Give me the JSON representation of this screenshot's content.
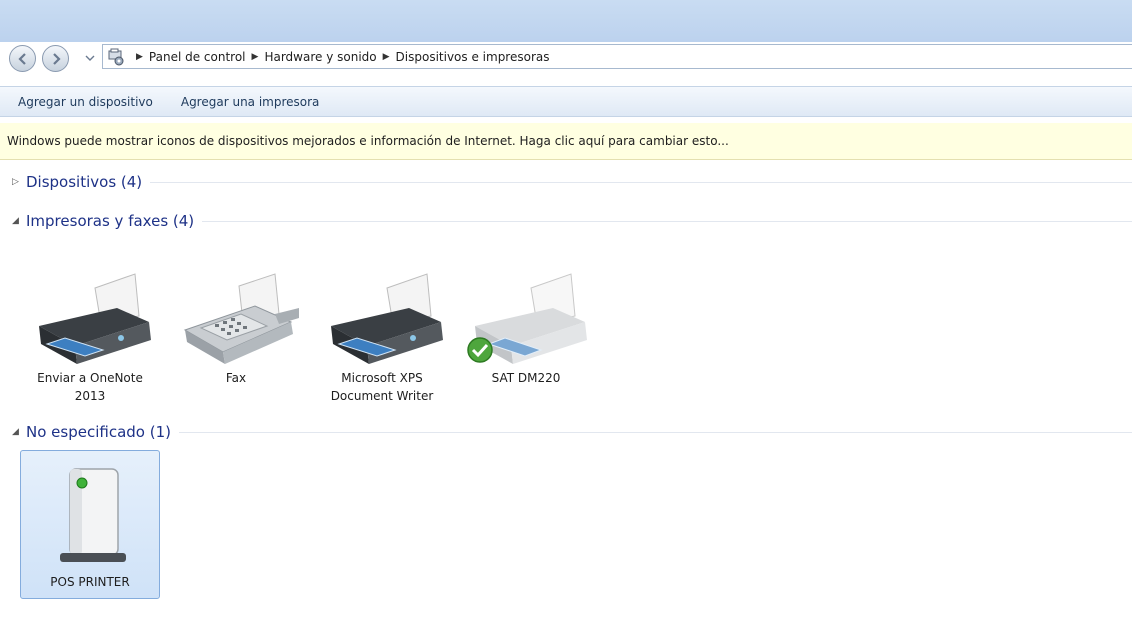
{
  "address": {
    "breadcrumbs": [
      "Panel de control",
      "Hardware y sonido",
      "Dispositivos e impresoras"
    ]
  },
  "toolbar": {
    "add_device": "Agregar un dispositivo",
    "add_printer": "Agregar una impresora"
  },
  "infobar": {
    "text": "Windows puede mostrar iconos de dispositivos mejorados e información de Internet. Haga clic aquí para cambiar esto..."
  },
  "groups": {
    "devices": {
      "title": "Dispositivos (4)",
      "expanded": false
    },
    "printers": {
      "title": "Impresoras y faxes (4)",
      "expanded": true,
      "items": [
        {
          "label_line1": "Enviar a OneNote",
          "label_line2": "2013",
          "icon": "printer-icon"
        },
        {
          "label_line1": "Fax",
          "label_line2": "",
          "icon": "fax-icon"
        },
        {
          "label_line1": "Microsoft XPS",
          "label_line2": "Document Writer",
          "icon": "printer-icon"
        },
        {
          "label_line1": "SAT DM220",
          "label_line2": "",
          "icon": "printer-icon",
          "default": true
        }
      ]
    },
    "unspecified": {
      "title": "No especificado (1)",
      "expanded": true,
      "items": [
        {
          "label_line1": "POS PRINTER",
          "icon": "generic-device-icon",
          "selected": true
        }
      ]
    }
  },
  "colors": {
    "group_title": "#1e3287",
    "infobar_bg": "#ffffe1",
    "selection_bg": "#cfe2f8"
  }
}
